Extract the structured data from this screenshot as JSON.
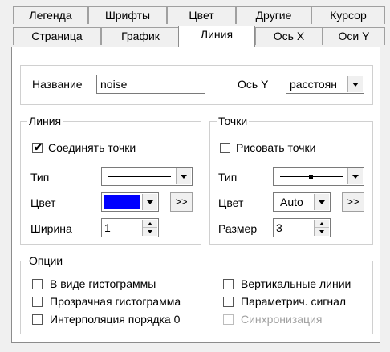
{
  "tabs_row1": [
    {
      "label": "Легенда"
    },
    {
      "label": "Шрифты"
    },
    {
      "label": "Цвет"
    },
    {
      "label": "Другие"
    },
    {
      "label": "Курсор"
    }
  ],
  "tabs_row2": [
    {
      "label": "Страница"
    },
    {
      "label": "График"
    },
    {
      "label": "Линия",
      "active": true
    },
    {
      "label": "Ось X"
    },
    {
      "label": "Оси Y"
    }
  ],
  "name": {
    "label": "Название",
    "value": "noise"
  },
  "axis_y": {
    "label": "Ось Y",
    "value": "расстоян"
  },
  "line_group": {
    "title": "Линия",
    "connect_points": {
      "label": "Соединять точки",
      "checked": true
    },
    "type_label": "Тип",
    "color_label": "Цвет",
    "color_value": "#0000ff",
    "more_button": ">>",
    "width_label": "Ширина",
    "width_value": "1"
  },
  "points_group": {
    "title": "Точки",
    "draw_points": {
      "label": "Рисовать точки",
      "checked": false
    },
    "type_label": "Тип",
    "color_label": "Цвет",
    "color_value": "Auto",
    "more_button": ">>",
    "size_label": "Размер",
    "size_value": "3"
  },
  "options_group": {
    "title": "Опции",
    "items": [
      {
        "label": "В виде гистограммы",
        "checked": false,
        "enabled": true
      },
      {
        "label": "Вертикальные линии",
        "checked": false,
        "enabled": true
      },
      {
        "label": "Прозрачная гистограмма",
        "checked": false,
        "enabled": true
      },
      {
        "label": "Параметрич. сигнал",
        "checked": false,
        "enabled": true
      },
      {
        "label": "Интерполяция порядка 0",
        "checked": false,
        "enabled": true
      },
      {
        "label": "Синхронизация",
        "checked": false,
        "enabled": false
      }
    ]
  }
}
